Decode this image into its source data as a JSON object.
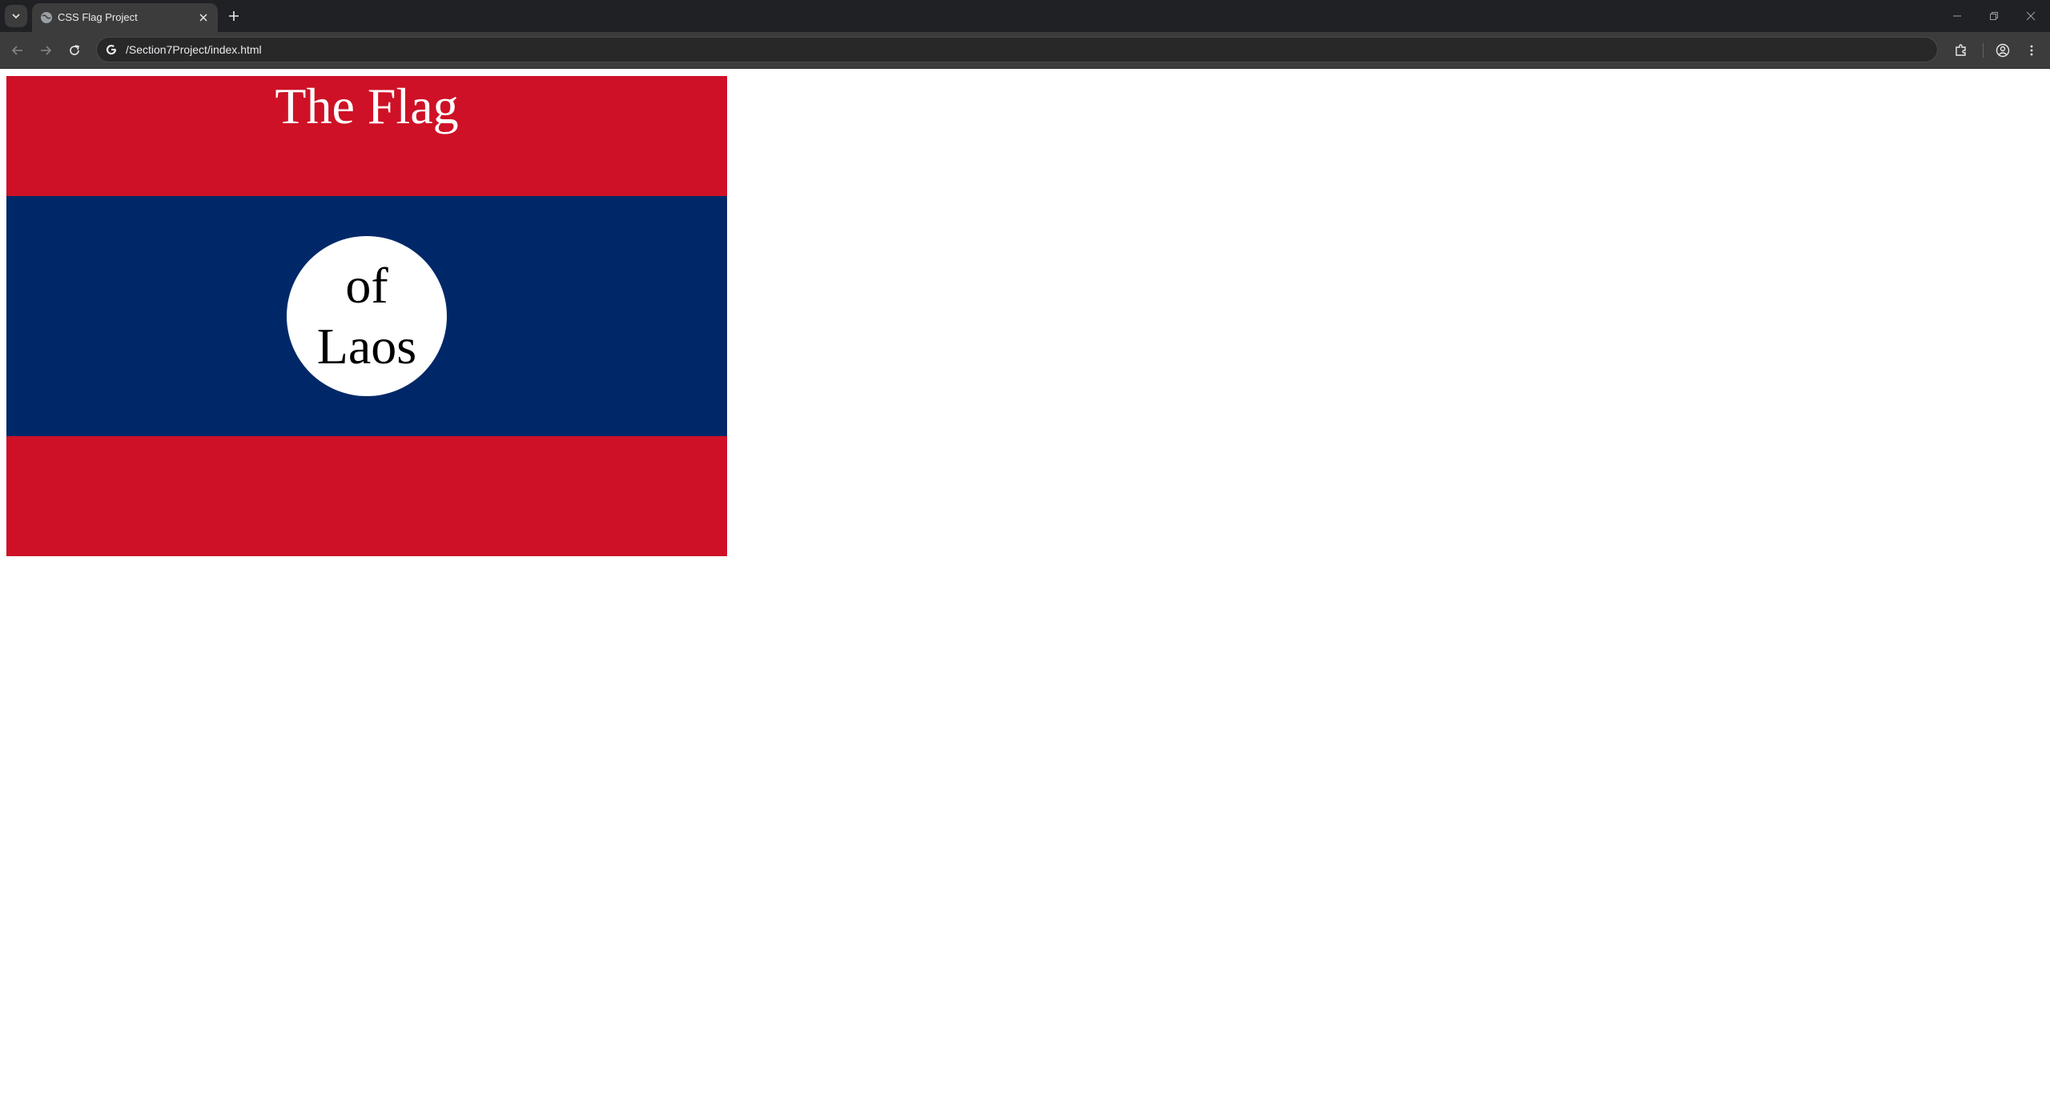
{
  "browser": {
    "tab": {
      "title": "CSS Flag Project",
      "favicon": "globe-icon",
      "close_icon": "close-icon"
    },
    "new_tab_icon": "plus-icon",
    "window_controls": [
      "minimize-icon",
      "restore-icon",
      "close-icon"
    ],
    "toolbar": {
      "back_icon": "back-arrow-icon",
      "forward_icon": "forward-arrow-icon",
      "reload_icon": "reload-icon",
      "site_icon": "google-g-icon",
      "url": "/Section7Project/index.html",
      "extensions_icon": "puzzle-icon",
      "profile_icon": "profile-icon",
      "menu_icon": "kebab-menu-icon"
    }
  },
  "page": {
    "flag": {
      "title": "The Flag",
      "circle_line1": "of",
      "circle_line2": "Laos",
      "colors": {
        "red": "#ce1126",
        "blue": "#002868",
        "white": "#ffffff"
      }
    }
  }
}
